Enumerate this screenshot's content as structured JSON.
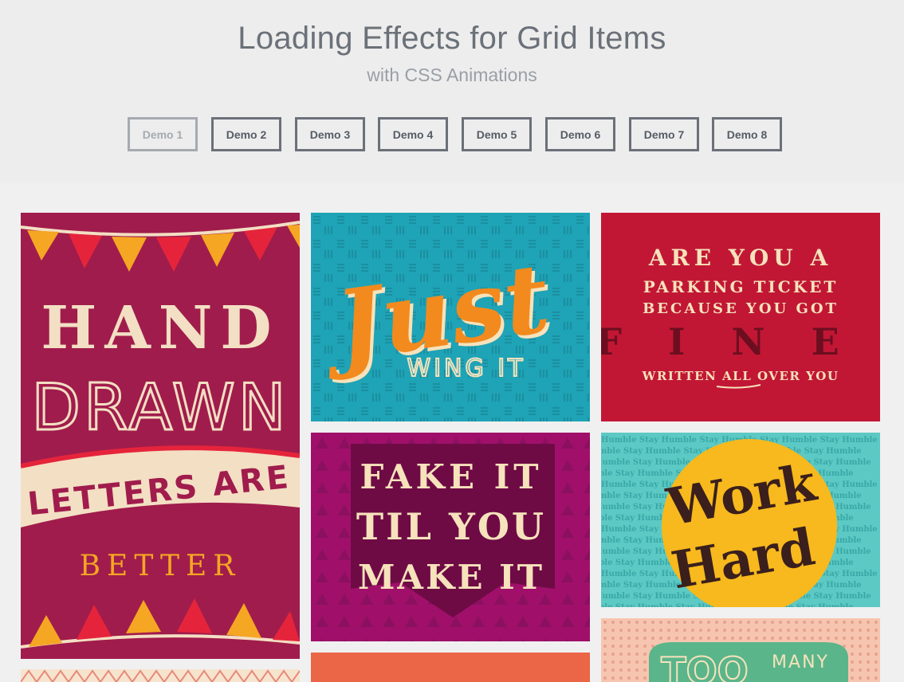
{
  "header": {
    "title": "Loading Effects for Grid Items",
    "subtitle": "with CSS Animations"
  },
  "nav": {
    "items": [
      {
        "label": "Demo 1",
        "current": true
      },
      {
        "label": "Demo 2",
        "current": false
      },
      {
        "label": "Demo 3",
        "current": false
      },
      {
        "label": "Demo 4",
        "current": false
      },
      {
        "label": "Demo 5",
        "current": false
      },
      {
        "label": "Demo 6",
        "current": false
      },
      {
        "label": "Demo 7",
        "current": false
      },
      {
        "label": "Demo 8",
        "current": false
      }
    ]
  },
  "grid": {
    "items": [
      {
        "lines": [
          "HAND",
          "DRAWN",
          "LETTERS ARE",
          "BETTER"
        ]
      },
      {
        "lines": [
          "Just",
          "WING IT"
        ]
      },
      {
        "lines": [
          "ARE YOU A",
          "PARKING TICKET",
          "BECAUSE YOU GOT",
          "FINE",
          "WRITTEN ALL OVER YOU"
        ]
      },
      {
        "lines": [
          "FAKE IT",
          "TIL YOU",
          "MAKE IT"
        ]
      },
      {
        "lines": [
          "Work",
          "Hard",
          "Humble Stay Humble Stay Humble Stay Humble Stay Humble"
        ]
      },
      {
        "lines": [
          "TOO",
          "MANY"
        ]
      }
    ]
  },
  "colors": {
    "accent_nav": "#6b7079",
    "card_hand_drawn": "#a01c4c",
    "card_just": "#1fa3b6",
    "card_parking": "#c11735",
    "card_fake": "#a0106a",
    "card_work": "#5cc9c4"
  }
}
